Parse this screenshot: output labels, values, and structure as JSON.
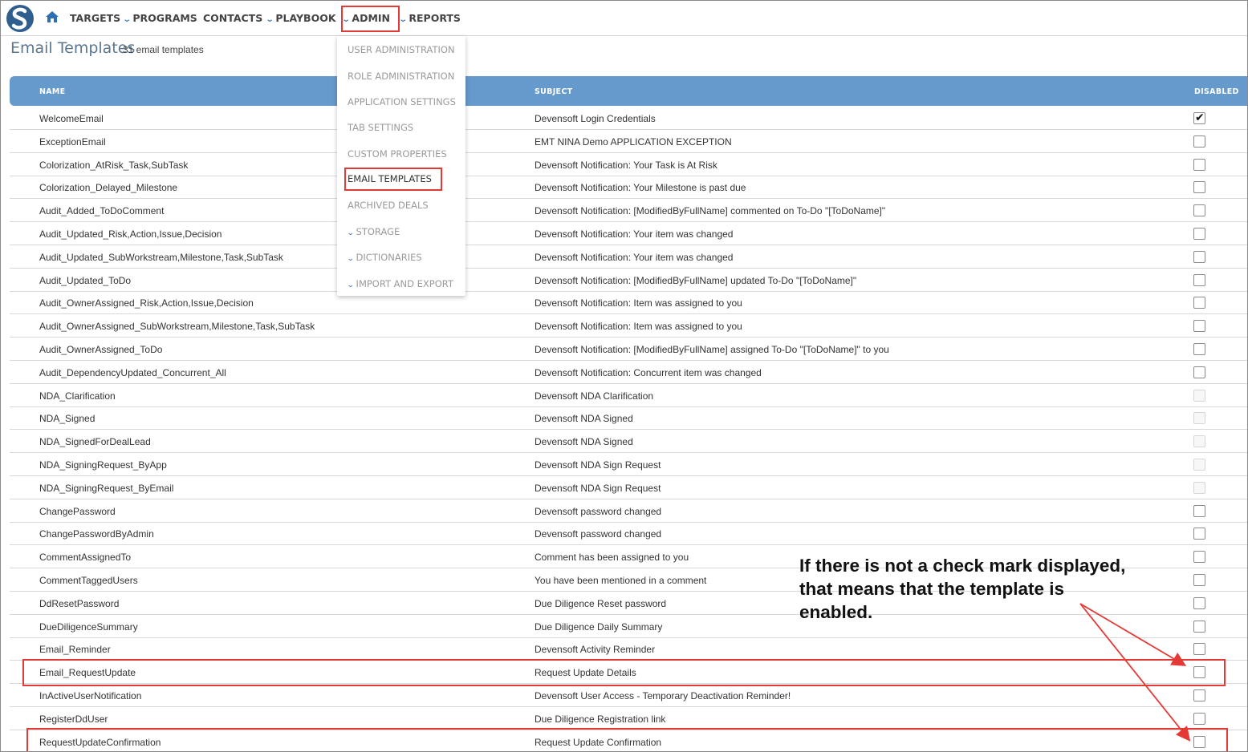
{
  "nav": {
    "items": [
      {
        "label": "TARGETS",
        "chevron": false
      },
      {
        "label": "PROGRAMS",
        "chevron": true
      },
      {
        "label": "CONTACTS",
        "chevron": false
      },
      {
        "label": "PLAYBOOK",
        "chevron": true
      },
      {
        "label": "ADMIN",
        "chevron": true
      },
      {
        "label": "REPORTS",
        "chevron": true
      }
    ],
    "chevron_glyph": "⌄",
    "icons": {
      "logo": "devensoft-s-logo",
      "home": "home-icon"
    }
  },
  "page": {
    "title": "Email Templates",
    "count": "31 email templates"
  },
  "table": {
    "headers": {
      "name": "NAME",
      "subject": "SUBJECT",
      "disabled": "DISABLED"
    },
    "rows": [
      {
        "name": "WelcomeEmail",
        "subject": "Devensoft Login Credentials",
        "disabled": true,
        "dim": false
      },
      {
        "name": "ExceptionEmail",
        "subject": "EMT NINA Demo APPLICATION EXCEPTION",
        "disabled": false,
        "dim": false
      },
      {
        "name": "Colorization_AtRisk_Task,SubTask",
        "subject": "Devensoft Notification: Your Task is At Risk",
        "disabled": false,
        "dim": false
      },
      {
        "name": "Colorization_Delayed_Milestone",
        "subject": "Devensoft Notification: Your Milestone is past due",
        "disabled": false,
        "dim": false
      },
      {
        "name": "Audit_Added_ToDoComment",
        "subject": "Devensoft Notification: [ModifiedByFullName] commented on To-Do \"[ToDoName]\"",
        "disabled": false,
        "dim": false
      },
      {
        "name": "Audit_Updated_Risk,Action,Issue,Decision",
        "subject": "Devensoft Notification: Your item was changed",
        "disabled": false,
        "dim": false
      },
      {
        "name": "Audit_Updated_SubWorkstream,Milestone,Task,SubTask",
        "subject": "Devensoft Notification: Your item was changed",
        "disabled": false,
        "dim": false
      },
      {
        "name": "Audit_Updated_ToDo",
        "subject": "Devensoft Notification: [ModifiedByFullName] updated To-Do \"[ToDoName]\"",
        "disabled": false,
        "dim": false
      },
      {
        "name": "Audit_OwnerAssigned_Risk,Action,Issue,Decision",
        "subject": "Devensoft Notification: Item was assigned to you",
        "disabled": false,
        "dim": false
      },
      {
        "name": "Audit_OwnerAssigned_SubWorkstream,Milestone,Task,SubTask",
        "subject": "Devensoft Notification: Item was assigned to you",
        "disabled": false,
        "dim": false
      },
      {
        "name": "Audit_OwnerAssigned_ToDo",
        "subject": "Devensoft Notification: [ModifiedByFullName] assigned To-Do \"[ToDoName]\" to you",
        "disabled": false,
        "dim": false
      },
      {
        "name": "Audit_DependencyUpdated_Concurrent_All",
        "subject": "Devensoft Notification: Concurrent item was changed",
        "disabled": false,
        "dim": false
      },
      {
        "name": "NDA_Clarification",
        "subject": "Devensoft NDA Clarification",
        "disabled": false,
        "dim": true
      },
      {
        "name": "NDA_Signed",
        "subject": "Devensoft NDA Signed",
        "disabled": false,
        "dim": true
      },
      {
        "name": "NDA_SignedForDealLead",
        "subject": "Devensoft NDA Signed",
        "disabled": false,
        "dim": true
      },
      {
        "name": "NDA_SigningRequest_ByApp",
        "subject": "Devensoft NDA Sign Request",
        "disabled": false,
        "dim": true
      },
      {
        "name": "NDA_SigningRequest_ByEmail",
        "subject": "Devensoft NDA Sign Request",
        "disabled": false,
        "dim": true
      },
      {
        "name": "ChangePassword",
        "subject": "Devensoft password changed",
        "disabled": false,
        "dim": false
      },
      {
        "name": "ChangePasswordByAdmin",
        "subject": "Devensoft password changed",
        "disabled": false,
        "dim": false
      },
      {
        "name": "CommentAssignedTo",
        "subject": "Comment has been assigned to you",
        "disabled": false,
        "dim": false
      },
      {
        "name": "CommentTaggedUsers",
        "subject": "You have been mentioned in a comment",
        "disabled": false,
        "dim": false
      },
      {
        "name": "DdResetPassword",
        "subject": "Due Diligence Reset password",
        "disabled": false,
        "dim": false
      },
      {
        "name": "DueDiligenceSummary",
        "subject": "Due Diligence Daily Summary",
        "disabled": false,
        "dim": false
      },
      {
        "name": "Email_Reminder",
        "subject": "Devensoft Activity Reminder",
        "disabled": false,
        "dim": false
      },
      {
        "name": "Email_RequestUpdate",
        "subject": "Request Update Details",
        "disabled": false,
        "dim": false
      },
      {
        "name": "InActiveUserNotification",
        "subject": "Devensoft User Access - Temporary Deactivation Reminder!",
        "disabled": false,
        "dim": false
      },
      {
        "name": "RegisterDdUser",
        "subject": "Due Diligence Registration link",
        "disabled": false,
        "dim": false
      },
      {
        "name": "RequestUpdateConfirmation",
        "subject": "Request Update Confirmation",
        "disabled": false,
        "dim": false
      }
    ]
  },
  "admin_menu": {
    "items": [
      {
        "label": "USER ADMINISTRATION",
        "chevron": false,
        "active": false
      },
      {
        "label": "ROLE ADMINISTRATION",
        "chevron": false,
        "active": false
      },
      {
        "label": "APPLICATION SETTINGS",
        "chevron": false,
        "active": false
      },
      {
        "label": "TAB SETTINGS",
        "chevron": false,
        "active": false
      },
      {
        "label": "CUSTOM PROPERTIES",
        "chevron": false,
        "active": false
      },
      {
        "label": "EMAIL TEMPLATES",
        "chevron": false,
        "active": true
      },
      {
        "label": "ARCHIVED DEALS",
        "chevron": false,
        "active": false
      },
      {
        "label": "STORAGE",
        "chevron": true,
        "active": false
      },
      {
        "label": "DICTIONARIES",
        "chevron": true,
        "active": false
      },
      {
        "label": "IMPORT AND EXPORT",
        "chevron": true,
        "active": false
      }
    ]
  },
  "annotation": {
    "lines": [
      "If there is not a check mark displayed,",
      "that means that the template is",
      "enabled."
    ],
    "highlight_color": "#e53935"
  },
  "colors": {
    "header_bg": "#6699cc",
    "title": "#5b7790",
    "accent": "#2d6fb3"
  }
}
